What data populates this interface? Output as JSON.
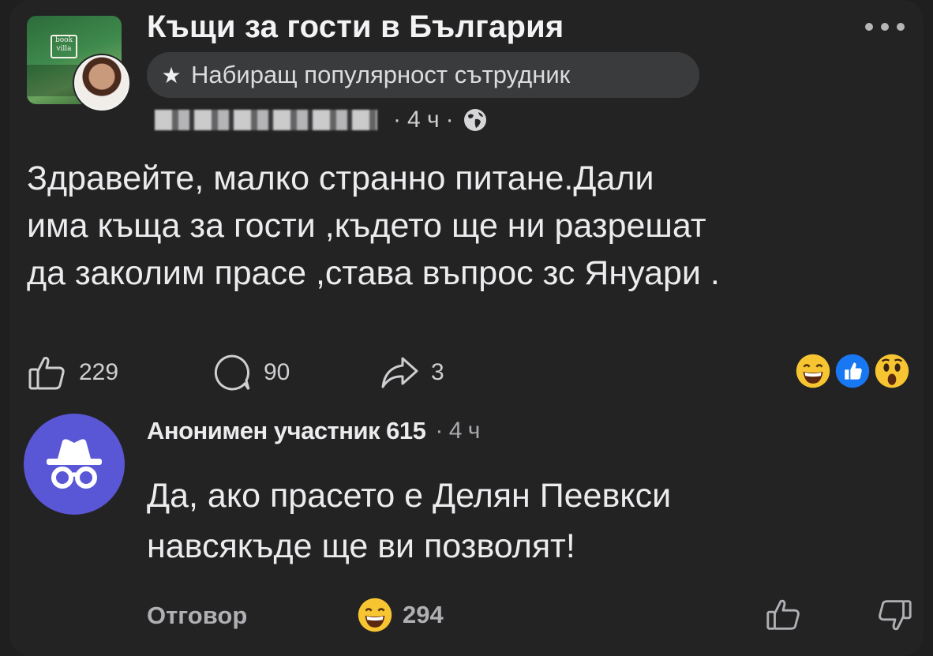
{
  "post": {
    "group_name": "Къщи за гости в България",
    "badge_label": "Набиращ популярност сътрудник",
    "time": "4 ч",
    "separator": "·",
    "text_lines": [
      "Здравейте, малко странно питане.Дали",
      "има къща за гости ,където ще ни разрешат",
      "да заколим прасе ,става въпрос зс Януари ."
    ],
    "likes": "229",
    "comments": "90",
    "shares": "3",
    "reactions": [
      "laughing-emoji",
      "like-emoji",
      "wow-emoji"
    ]
  },
  "comment": {
    "author": "Анонимен участник 615",
    "time": "· 4 ч",
    "text_lines": [
      "Да, ако прасето е Делян Пеевкси",
      "навсякъде ще ви позволят!"
    ],
    "reply_label": "Отговор",
    "reaction_count": "294"
  },
  "colors": {
    "background": "#232324",
    "badge_bg": "#3a3b3d",
    "anon_avatar": "#5a57d6",
    "like_blue": "#1877f2",
    "emoji_yellow": "#f7c531"
  }
}
